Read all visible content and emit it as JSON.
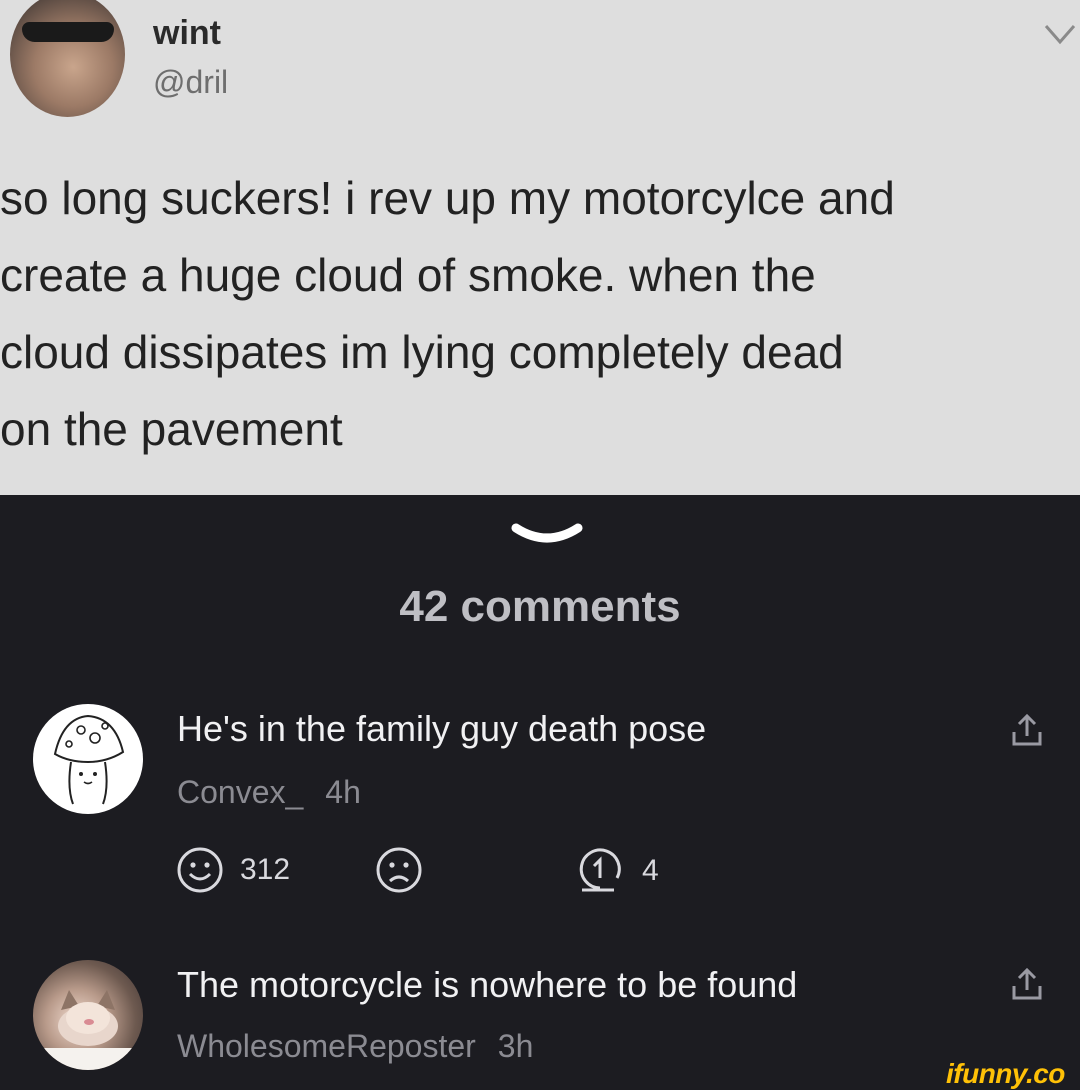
{
  "tweet": {
    "name": "wint",
    "handle": "@dril",
    "text": "so long suckers! i rev up my motorcylce and\ncreate a huge cloud of smoke. when the\ncloud dissipates im lying completely dead\non the pavement"
  },
  "comments_header": {
    "count_label": "42 comments"
  },
  "comments": [
    {
      "text": "He's in the family guy death pose",
      "author": "Convex_",
      "time": "4h",
      "smiles": "312",
      "replies": "4"
    },
    {
      "text": "The motorcycle is nowhere to be found",
      "author": "WholesomeReposter",
      "time": "3h"
    }
  ],
  "watermark": "ifunny.co",
  "colors": {
    "panel_bg": "#1c1c21",
    "tweet_bg": "#dedede",
    "watermark": "#ffc107"
  }
}
